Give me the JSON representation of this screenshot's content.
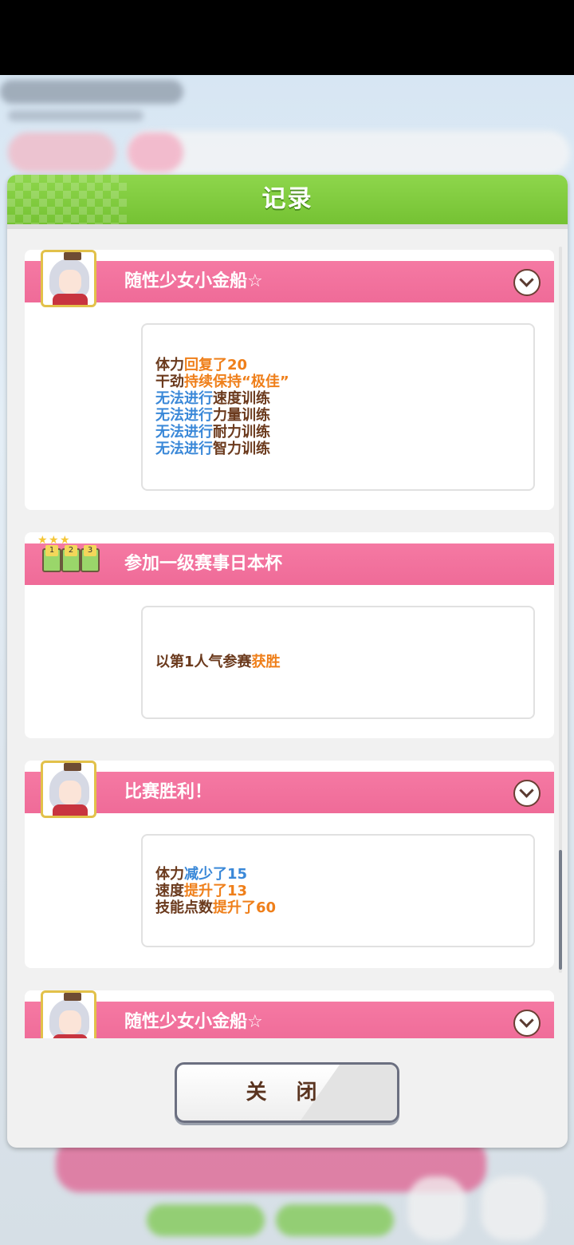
{
  "dialog": {
    "title": "记录",
    "close_label": "关 闭"
  },
  "records": [
    {
      "title": "随性少女小金船☆",
      "icon": "character-avatar-icon",
      "expandable": true,
      "lines": [
        [
          {
            "t": "体力",
            "c": "brown"
          },
          {
            "t": "回复了20",
            "c": "orange"
          }
        ],
        [
          {
            "t": "干劲",
            "c": "brown"
          },
          {
            "t": "持续保持“极佳”",
            "c": "orange"
          }
        ],
        [
          {
            "t": "无法进行",
            "c": "blue"
          },
          {
            "t": "速度训练",
            "c": "brown"
          }
        ],
        [
          {
            "t": "无法进行",
            "c": "blue"
          },
          {
            "t": "力量训练",
            "c": "brown"
          }
        ],
        [
          {
            "t": "无法进行",
            "c": "blue"
          },
          {
            "t": "耐力训练",
            "c": "brown"
          }
        ],
        [
          {
            "t": "无法进行",
            "c": "blue"
          },
          {
            "t": "智力训练",
            "c": "brown"
          }
        ]
      ]
    },
    {
      "title": "参加一级赛事日本杯",
      "icon": "race-gate-icon",
      "expandable": false,
      "lines": [
        [
          {
            "t": "以第1人气参赛",
            "c": "brown"
          },
          {
            "t": "获胜",
            "c": "orange"
          }
        ]
      ]
    },
    {
      "title": "比赛胜利！",
      "icon": "character-avatar-icon",
      "expandable": true,
      "lines": [
        [
          {
            "t": "体力",
            "c": "brown"
          },
          {
            "t": "减少了15",
            "c": "blue"
          }
        ],
        [
          {
            "t": "速度",
            "c": "brown"
          },
          {
            "t": "提升了13",
            "c": "orange"
          }
        ],
        [
          {
            "t": "技能点数",
            "c": "brown"
          },
          {
            "t": "提升了60",
            "c": "orange"
          }
        ]
      ]
    },
    {
      "title": "随性少女小金船☆",
      "icon": "character-avatar-icon",
      "expandable": true,
      "lines": []
    }
  ],
  "colors": {
    "header_green": "#7cc83a",
    "band_pink": "#f273a0",
    "text_brown": "#6b3a1d",
    "text_orange": "#ef7f1a",
    "text_blue": "#3a88d8"
  }
}
